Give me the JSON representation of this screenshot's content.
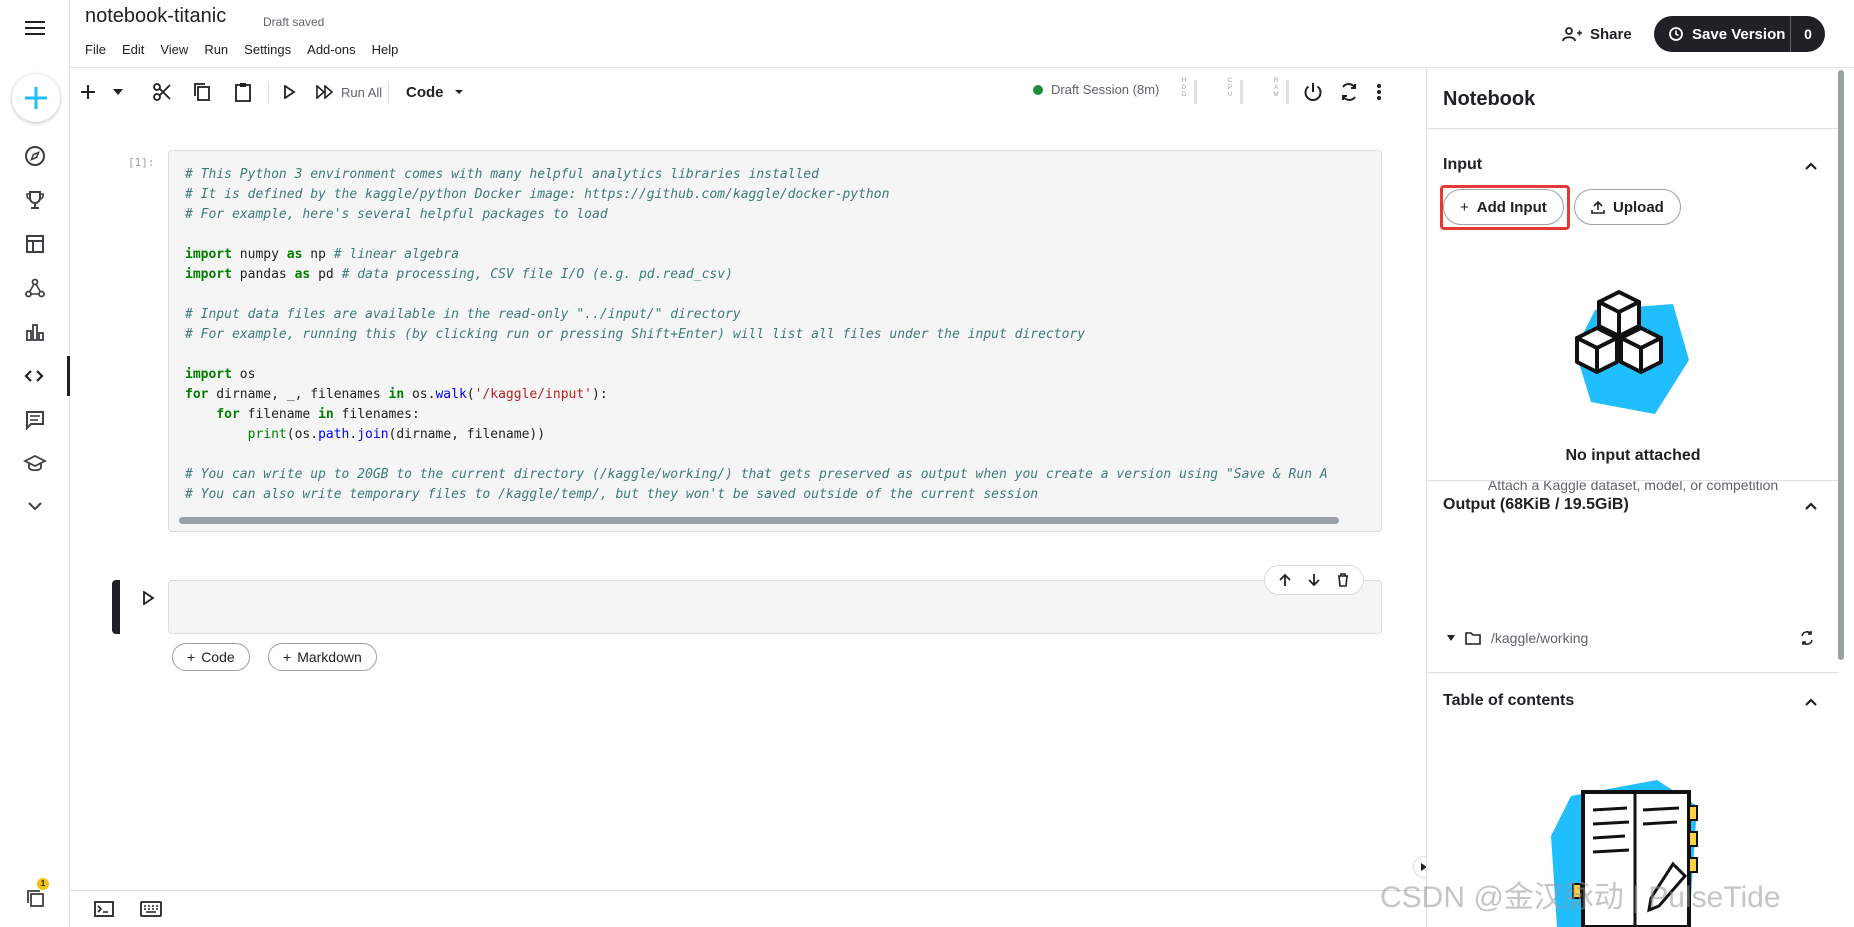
{
  "header": {
    "title": "notebook-titanic",
    "status": "Draft saved",
    "menu": [
      "File",
      "Edit",
      "View",
      "Run",
      "Settings",
      "Add-ons",
      "Help"
    ],
    "share_label": "Share",
    "save_version_label": "Save Version",
    "save_version_count": "0"
  },
  "toolbar": {
    "run_all_label": "Run All",
    "cell_type": "Code",
    "session_label": "Draft Session (8m)",
    "meters": [
      "HDD",
      "CPU",
      "RAM"
    ]
  },
  "cells": [
    {
      "prompt": "[1]:",
      "code_lines": [
        "# This Python 3 environment comes with many helpful analytics libraries installed",
        "# It is defined by the kaggle/python Docker image: https://github.com/kaggle/docker-python",
        "# For example, here's several helpful packages to load",
        "",
        "import numpy as np # linear algebra",
        "import pandas as pd # data processing, CSV file I/O (e.g. pd.read_csv)",
        "",
        "# Input data files are available in the read-only \"../input/\" directory",
        "# For example, running this (by clicking run or pressing Shift+Enter) will list all files under the input directory",
        "",
        "import os",
        "for dirname, _, filenames in os.walk('/kaggle/input'):",
        "    for filename in filenames:",
        "        print(os.path.join(dirname, filename))",
        "",
        "# You can write up to 20GB to the current directory (/kaggle/working/) that gets preserved as output when you create a version using \"Save & Run A",
        "# You can also write temporary files to /kaggle/temp/, but they won't be saved outside of the current session"
      ]
    }
  ],
  "add_cell": {
    "code_label": "Code",
    "markdown_label": "Markdown"
  },
  "panel": {
    "title": "Notebook",
    "input_section": {
      "title": "Input",
      "add_input_label": "Add Input",
      "upload_label": "Upload",
      "empty_title": "No input attached",
      "empty_subtitle": "Attach a Kaggle dataset, model, or competition"
    },
    "output_section": {
      "title": "Output (68KiB / 19.5GiB)",
      "path": "/kaggle/working"
    },
    "toc_section": {
      "title": "Table of contents"
    }
  },
  "rail": {
    "notification_count": "1",
    "icons": [
      "menu-icon",
      "create-icon",
      "explore-icon",
      "trophy-icon",
      "datasets-icon",
      "models-icon",
      "chart-icon",
      "code-icon",
      "discussion-icon",
      "learn-icon",
      "more-icon",
      "notifications-icon"
    ]
  },
  "colors": {
    "accent": "#20beff",
    "primary_dark": "#202124",
    "highlight": "#e53935",
    "session_green": "#1e8e3e"
  },
  "watermark": "CSDN @金汉脉动 | PulseTide"
}
